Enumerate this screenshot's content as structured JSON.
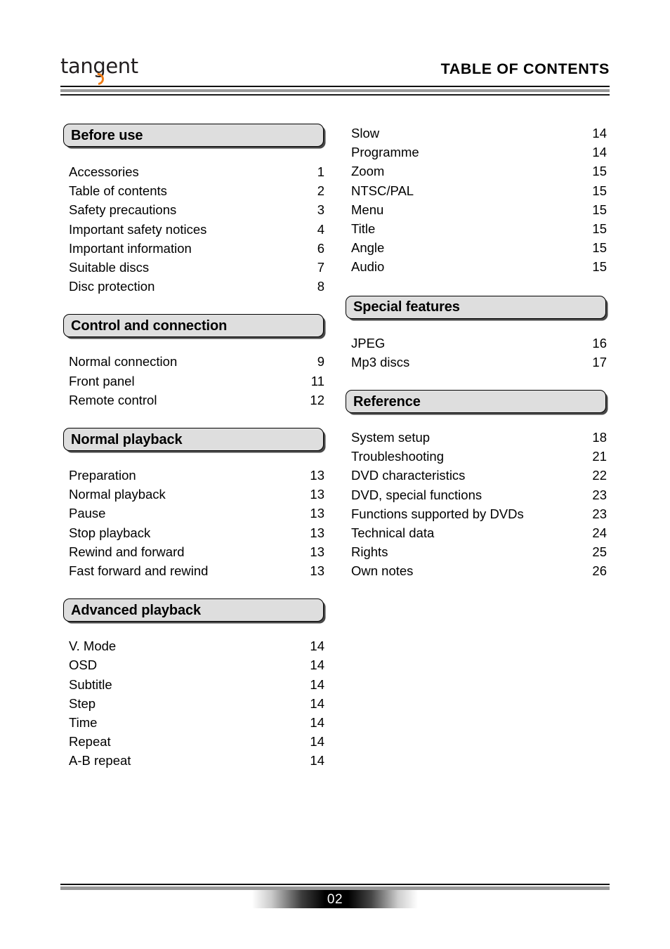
{
  "header": {
    "logo_text": "tangent",
    "logo_accent_color": "#f07d17",
    "title": "TABLE OF CONTENTS"
  },
  "footer": {
    "page_number": "02"
  },
  "left_column": [
    {
      "section": "Before use",
      "entries": [
        {
          "title": "Accessories",
          "page": "1"
        },
        {
          "title": "Table of contents",
          "page": "2"
        },
        {
          "title": "Safety precautions",
          "page": "3"
        },
        {
          "title": "Important safety notices",
          "page": "4"
        },
        {
          "title": "Important information",
          "page": "6"
        },
        {
          "title": "Suitable discs",
          "page": "7"
        },
        {
          "title": "Disc protection",
          "page": "8"
        }
      ]
    },
    {
      "section": "Control and connection",
      "entries": [
        {
          "title": "Normal connection",
          "page": "9"
        },
        {
          "title": "Front panel",
          "page": "11"
        },
        {
          "title": "Remote control",
          "page": "12"
        }
      ]
    },
    {
      "section": "Normal playback",
      "entries": [
        {
          "title": "Preparation",
          "page": "13"
        },
        {
          "title": "Normal playback",
          "page": "13"
        },
        {
          "title": "Pause",
          "page": "13"
        },
        {
          "title": "Stop playback",
          "page": "13"
        },
        {
          "title": "Rewind and forward",
          "page": "13"
        },
        {
          "title": "Fast forward and rewind",
          "page": "13"
        }
      ]
    },
    {
      "section": "Advanced playback",
      "entries": [
        {
          "title": "V. Mode",
          "page": "14"
        },
        {
          "title": "OSD",
          "page": "14"
        },
        {
          "title": "Subtitle",
          "page": "14"
        },
        {
          "title": "Step",
          "page": "14"
        },
        {
          "title": "Time",
          "page": "14"
        },
        {
          "title": "Repeat",
          "page": "14"
        },
        {
          "title": "A-B repeat",
          "page": "14"
        }
      ]
    }
  ],
  "right_column_continuation": [
    {
      "title": "Slow",
      "page": "14"
    },
    {
      "title": "Programme",
      "page": "14"
    },
    {
      "title": "Zoom",
      "page": "15"
    },
    {
      "title": "NTSC/PAL",
      "page": "15"
    },
    {
      "title": "Menu",
      "page": "15"
    },
    {
      "title": "Title",
      "page": "15"
    },
    {
      "title": "Angle",
      "page": "15"
    },
    {
      "title": "Audio",
      "page": "15"
    }
  ],
  "right_column": [
    {
      "section": "Special features",
      "entries": [
        {
          "title": "JPEG",
          "page": "16"
        },
        {
          "title": "Mp3 discs",
          "page": "17"
        }
      ]
    },
    {
      "section": "Reference",
      "entries": [
        {
          "title": "System setup",
          "page": "18"
        },
        {
          "title": "Troubleshooting",
          "page": "21"
        },
        {
          "title": "DVD characteristics",
          "page": "22"
        },
        {
          "title": "DVD, special functions",
          "page": "23"
        },
        {
          "title": "Functions supported by DVDs",
          "page": "23"
        },
        {
          "title": "Technical data",
          "page": "24"
        },
        {
          "title": "Rights",
          "page": "25"
        },
        {
          "title": "Own notes",
          "page": "26"
        }
      ]
    }
  ]
}
